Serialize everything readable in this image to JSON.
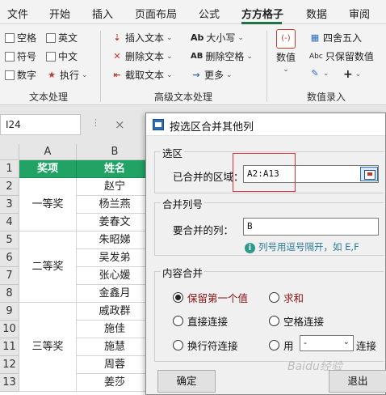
{
  "ribbon_tabs": [
    "文件",
    "开始",
    "插入",
    "页面布局",
    "公式",
    "方方格子",
    "数据",
    "审阅"
  ],
  "text_group": {
    "checkboxes": [
      "空格",
      "英文",
      "符号",
      "中文",
      "数字"
    ],
    "execute_label": "执行",
    "label": "文本处理"
  },
  "advanced_group": {
    "insert_text": "插入文本",
    "delete_text": "删除文本",
    "extract_text": "截取文本",
    "case": "大小写",
    "case_icon_text": "Ab",
    "delete_space": "删除空格",
    "delete_space_icon_text": "AB",
    "more": "更多",
    "label": "高级文本处理"
  },
  "number_group": {
    "number_button": "数值",
    "round": "四舍五入",
    "keep_number": "只保留数值",
    "keep_number_icon_text": "Abc",
    "label": "数值录入"
  },
  "formula_bar": {
    "name_box": "I24",
    "cancel_symbol": "×"
  },
  "sheet": {
    "columns": [
      "A",
      "B"
    ],
    "rows": [
      "1",
      "2",
      "3",
      "4",
      "5",
      "6",
      "7",
      "8",
      "9",
      "10",
      "11",
      "12",
      "13"
    ],
    "header": [
      "奖项",
      "姓名"
    ],
    "groups": [
      "一等奖",
      "二等奖",
      "三等奖"
    ],
    "names": [
      "赵宁",
      "杨兰燕",
      "姜春文",
      "朱昭娣",
      "吴发弟",
      "张心媛",
      "金鑫月",
      "戚政群",
      "施佳",
      "施慧",
      "周蓉",
      "姜莎"
    ]
  },
  "dialog": {
    "title": "按选区合并其他列",
    "selection_legend": "选区",
    "merged_range_label": "已合并的区域：",
    "merged_range_value": "A2:A13",
    "merge_col_legend": "合并列号",
    "merge_col_label": "要合并的列：",
    "merge_col_value": "B",
    "hint": "列号用逗号隔开，如 E,F",
    "content_legend": "内容合并",
    "options": [
      "保留第一个值",
      "求和",
      "直接连接",
      "空格连接",
      "换行符连接",
      "用"
    ],
    "separator_value": "-",
    "connect_label": "连接",
    "ok": "确定",
    "exit": "退出"
  },
  "watermark": "Baidu经验"
}
